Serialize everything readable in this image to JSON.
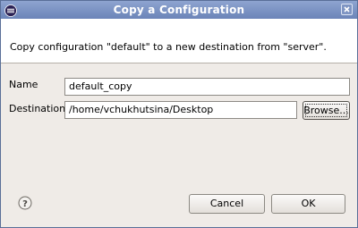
{
  "window": {
    "title": "Copy a Configuration",
    "app_icon": "eclipse-logo-icon",
    "close_icon": "close-icon"
  },
  "banner": {
    "message": "Copy configuration \"default\" to a new destination from \"server\"."
  },
  "form": {
    "name_label": "Name",
    "name_value": "default_copy",
    "destination_label": "Destination",
    "destination_value": "/home/vchukhutsina/Desktop",
    "browse_label": "Browse..."
  },
  "footer": {
    "help_icon": "help-icon",
    "cancel_label": "Cancel",
    "ok_label": "OK"
  },
  "colors": {
    "titlebar": "#7a91c4",
    "dialog_bg": "#efebe7",
    "banner_bg": "#ffffff"
  }
}
